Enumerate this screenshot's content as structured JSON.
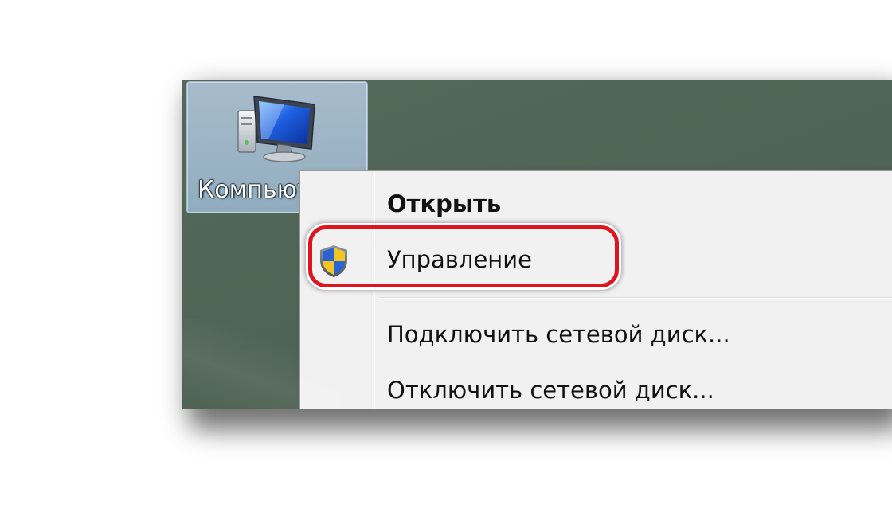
{
  "desktop": {
    "icon": {
      "label": "Компьютер",
      "icon_name": "computer-icon",
      "selected": true
    },
    "background_color": "#506455"
  },
  "context_menu": {
    "items": [
      {
        "label": "Открыть",
        "bold": true
      },
      {
        "label": "Управление",
        "icon_name": "uac-shield-icon",
        "highlighted_by_annotation": true
      },
      {
        "label": "Подключить сетевой диск..."
      },
      {
        "label": "Отключить сетевой диск..."
      }
    ]
  },
  "annotation": {
    "type": "highlight-ring",
    "target": "Управление",
    "color": "#e0141f"
  }
}
